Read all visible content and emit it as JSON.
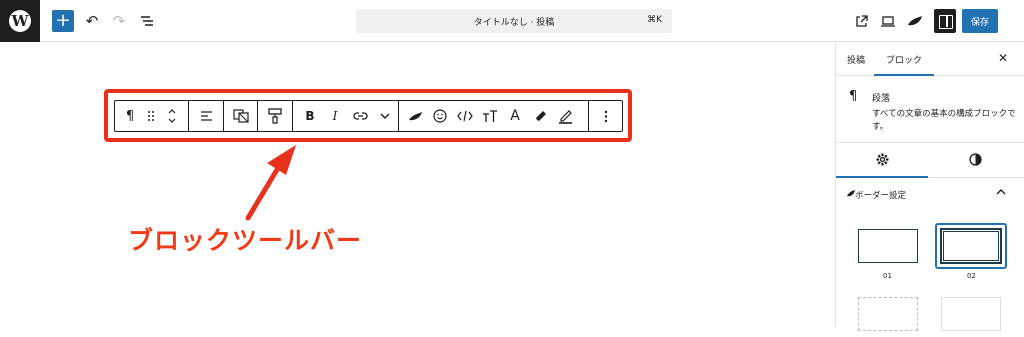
{
  "topbar": {
    "document_title": "タイトルなし · 投稿",
    "shortcut": "⌘K",
    "save_label": "保存",
    "accent_color": "#2271b1"
  },
  "sidebar": {
    "tabs": [
      "投稿",
      "ブロック"
    ],
    "active_tab": "ブロック",
    "close_icon": "close-icon",
    "block_card": {
      "name": "段落",
      "description": "すべての文章の基本の構成ブロックです。"
    },
    "icon_tabs": [
      "settings-gear-icon",
      "styles-contrast-icon"
    ],
    "panel": {
      "label": "ボーダー設定",
      "expanded": true
    },
    "styles": [
      {
        "label": "01"
      },
      {
        "label": "02"
      }
    ]
  },
  "block_toolbar": {
    "groups": [
      [
        "paragraph-icon",
        "drag-handle-icon",
        "move-up-down-icon"
      ],
      [
        "align-left-icon"
      ],
      [
        "block-variation-icon"
      ],
      [
        "format-paint-icon"
      ],
      [
        "bold-icon",
        "italic-icon",
        "link-icon",
        "more-options-chevron-icon"
      ],
      [
        "plugin-leaf-icon",
        "emoji-icon",
        "code-icon",
        "font-size-icon",
        "text-color-icon",
        "highlighter-icon",
        "marker-icon"
      ],
      [
        "options-kebab-icon"
      ]
    ]
  },
  "annotation": {
    "text": "ブロックツールバー",
    "color": "#e8321c"
  }
}
